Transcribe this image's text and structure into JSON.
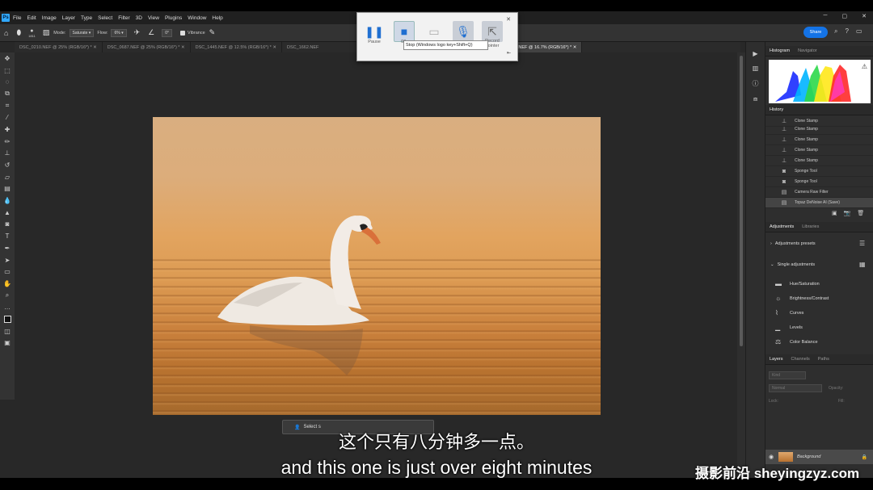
{
  "menu": [
    "File",
    "Edit",
    "Image",
    "Layer",
    "Type",
    "Select",
    "Filter",
    "3D",
    "View",
    "Plugins",
    "Window",
    "Help"
  ],
  "options": {
    "mode_label": "Mode:",
    "mode_value": "Saturate",
    "flow_label": "Flow:",
    "flow_value": "6%",
    "angle_value": "0°",
    "vibrance_label": "Vibrance",
    "brush_size": "1811",
    "share_label": "Share"
  },
  "tabs": [
    "DSC_0210.NEF @ 25% (RGB/16*) *",
    "DSC_0687.NEF @ 25% (RGB/16*) *",
    "DSC_1445.NEF @ 12.5% (RGB/16*) *",
    "DSC_1662.NEF",
    "DSC_0314.NEF @ 16.7% (RGB/16*) *"
  ],
  "recorder": {
    "pause_label": "Pause",
    "stop_label": "00:",
    "record_label": "Record",
    "pointer_label": "Record pointer",
    "tooltip": "Stop (Windows logo key+Shift+Q)"
  },
  "context_bar": {
    "select_label": "Select s"
  },
  "panels": {
    "histogram_tab": "Histogram",
    "navigator_tab": "Navigator",
    "history_tab": "History",
    "history_items": [
      "Clone Stamp",
      "Clone Stamp",
      "Clone Stamp",
      "Clone Stamp",
      "Clone Stamp",
      "Sponge Tool",
      "Sponge Tool",
      "Camera Raw Filter",
      "Topaz DeNoise AI (Save)"
    ],
    "adjustments_tab": "Adjustments",
    "libraries_tab": "Libraries",
    "adjustment_presets": "Adjustments presets",
    "single_adjustments": "Single adjustments",
    "adjustment_items": [
      "Hue/Saturation",
      "Brightness/Contrast",
      "Curves",
      "Levels",
      "Color Balance"
    ],
    "layers_tab": "Layers",
    "channels_tab": "Channels",
    "paths_tab": "Paths",
    "layer_kind": "Kind",
    "blend_mode": "Normal",
    "opacity_label": "Opacity:",
    "lock_label": "Lock:",
    "fill_label": "Fill:",
    "layer_name": "Background"
  },
  "subtitle_cn": "这个只有八分钟多一点。",
  "subtitle_en": "and this one is just over eight minutes",
  "watermark": "摄影前沿 sheyingzyz.com"
}
